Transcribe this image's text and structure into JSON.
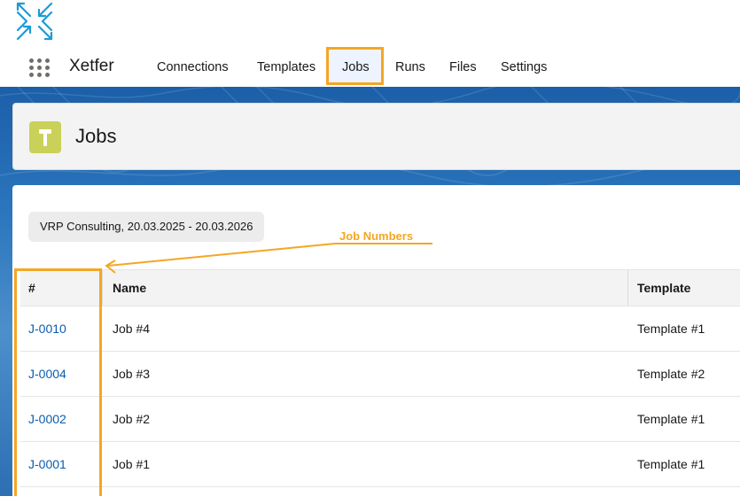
{
  "brand": {
    "app_name": "Xetfer",
    "logo_icon": "xetfer-cross-arrows-logo",
    "accent": "#1b9ad6"
  },
  "nav": {
    "items": [
      {
        "label": "Connections"
      },
      {
        "label": "Templates"
      },
      {
        "label": "Jobs",
        "active": true
      },
      {
        "label": "Runs"
      },
      {
        "label": "Files"
      },
      {
        "label": "Settings"
      }
    ]
  },
  "page": {
    "title": "Jobs",
    "icon": "hammer-icon",
    "icon_color": "#c9d158"
  },
  "filter": {
    "label": "VRP Consulting, 20.03.2025 - 20.03.2026"
  },
  "table": {
    "columns": [
      "#",
      "Name",
      "Template"
    ],
    "rows": [
      {
        "number": "J-0010",
        "name": "Job #4",
        "template": "Template #1"
      },
      {
        "number": "J-0004",
        "name": "Job #3",
        "template": "Template #2"
      },
      {
        "number": "J-0002",
        "name": "Job #2",
        "template": "Template #1"
      },
      {
        "number": "J-0001",
        "name": "Job #1",
        "template": "Template #1"
      }
    ]
  },
  "annotation": {
    "label": "Job Numbers",
    "color": "#f5a623"
  }
}
